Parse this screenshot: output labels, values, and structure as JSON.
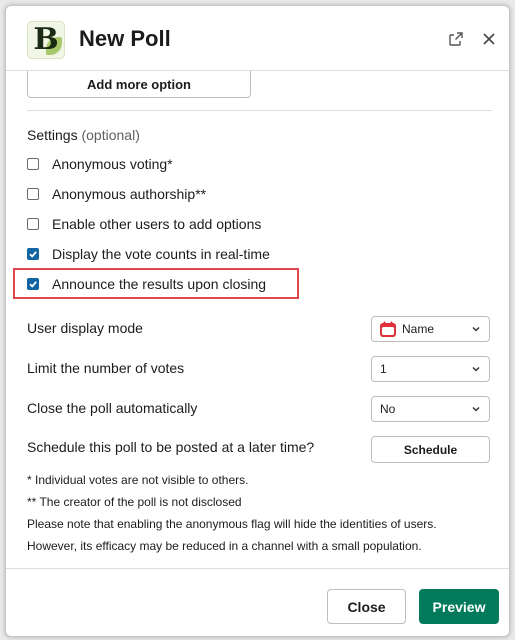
{
  "header": {
    "logo_letter": "B",
    "title": "New Poll",
    "open_external_icon": "external-link-icon",
    "close_icon": "close-icon"
  },
  "options": {
    "add_more_label": "Add more option"
  },
  "settings": {
    "heading": "Settings",
    "heading_optional": "(optional)",
    "checkboxes": [
      {
        "label": "Anonymous voting*",
        "checked": false
      },
      {
        "label": "Anonymous authorship**",
        "checked": false
      },
      {
        "label": "Enable other users to add options",
        "checked": false
      },
      {
        "label": "Display the vote counts in real-time",
        "checked": true
      },
      {
        "label": "Announce the results upon closing",
        "checked": true
      }
    ],
    "fields": [
      {
        "label": "User display mode",
        "value": "Name",
        "icon": "calendar-icon"
      },
      {
        "label": "Limit the number of votes",
        "value": "1"
      },
      {
        "label": "Close the poll automatically",
        "value": "No"
      },
      {
        "label": "Schedule this poll to be posted at a later time?",
        "button": "Schedule"
      }
    ],
    "notes": [
      "* Individual votes are not visible to others.",
      "** The creator of the poll is not disclosed",
      "Please note that enabling the anonymous flag will hide the identities of users.",
      "However, its efficacy may be reduced in a channel with a small population."
    ]
  },
  "footer": {
    "close_label": "Close",
    "preview_label": "Preview"
  },
  "colors": {
    "primary": "#007a5a",
    "checkbox": "#1264a3",
    "highlight": "#e0474c"
  }
}
